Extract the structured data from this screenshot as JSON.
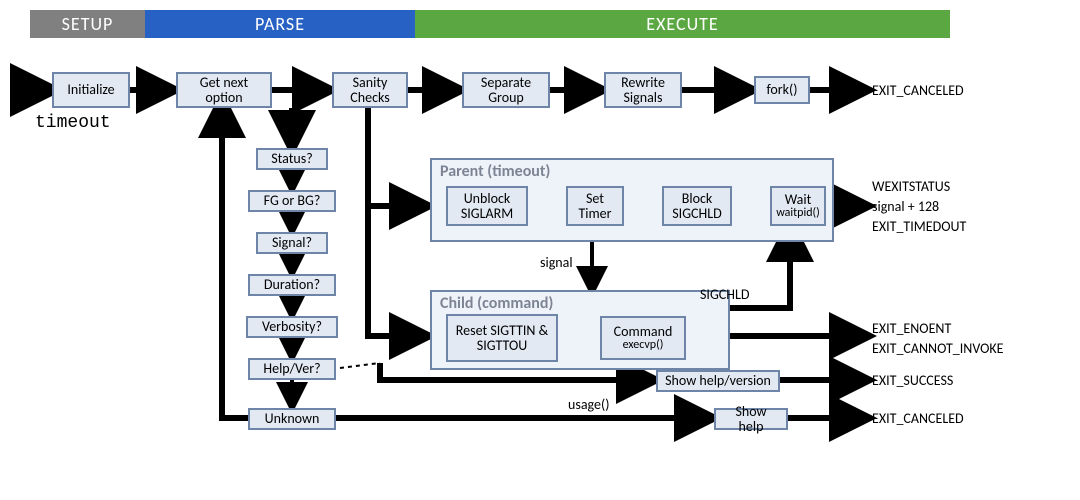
{
  "phases": {
    "setup": "SETUP",
    "parse": "PARSE",
    "execute": "EXECUTE"
  },
  "entry_label": "timeout",
  "nodes": {
    "init": "Initialize",
    "getnext": "Get next option",
    "sanity": "Sanity Checks",
    "sepgrp": "Separate Group",
    "rewrite": "Rewrite Signals",
    "fork": "fork()",
    "status": "Status?",
    "fgbg": "FG or BG?",
    "signal": "Signal?",
    "duration": "Duration?",
    "verbosity": "Verbosity?",
    "helpver": "Help/Ver?",
    "unknown": "Unknown",
    "unblock": "Unblock SIGLARM",
    "settimer": "Set Timer",
    "blockchld": "Block SIGCHLD",
    "wait_t": "Wait",
    "wait_sub": "waitpid()",
    "reset": "Reset SIGTTIN & SIGTTOU",
    "cmd_t": "Command",
    "cmd_sub": "execvp()",
    "showhv": "Show help/version",
    "showh": "Show help"
  },
  "groups": {
    "parent": "Parent (timeout)",
    "child": "Child (command)"
  },
  "edge_labels": {
    "signal": "signal",
    "sigchld": "SIGCHLD",
    "usage": "usage()"
  },
  "outputs": {
    "fork": "EXIT_CANCELED",
    "wait1": "WEXITSTATUS",
    "wait2": "signal + 128",
    "wait3": "EXIT_TIMEDOUT",
    "cmd1": "EXIT_ENOENT",
    "cmd2": "EXIT_CANNOT_INVOKE",
    "hv": "EXIT_SUCCESS",
    "unk": "EXIT_CANCELED"
  }
}
